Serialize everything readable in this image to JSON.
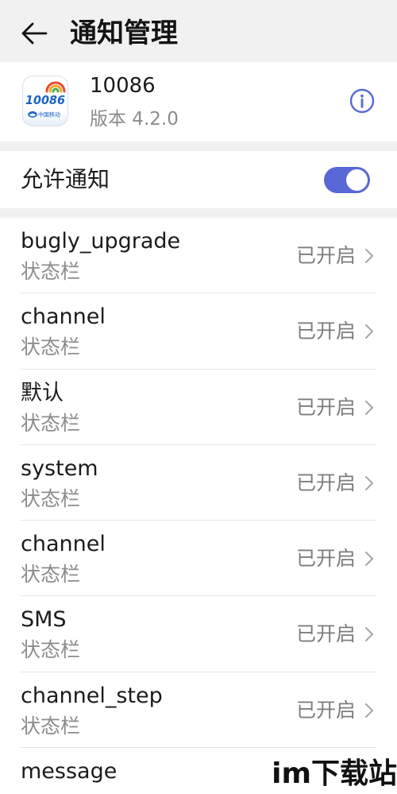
{
  "header": {
    "back_icon": "arrow-left-icon",
    "title": "通知管理"
  },
  "app": {
    "icon": "china-mobile-10086-app-icon",
    "icon_text": "10086",
    "icon_caption": "中国移动",
    "name": "10086",
    "version": "版本 4.2.0",
    "info_icon": "info-circle-icon"
  },
  "allow": {
    "label": "允许通知",
    "enabled": true
  },
  "channels": [
    {
      "title": "bugly_upgrade",
      "subtitle": "状态栏",
      "status": "已开启"
    },
    {
      "title": "channel",
      "subtitle": "状态栏",
      "status": "已开启"
    },
    {
      "title": "默认",
      "subtitle": "状态栏",
      "status": "已开启"
    },
    {
      "title": "system",
      "subtitle": "状态栏",
      "status": "已开启"
    },
    {
      "title": "channel",
      "subtitle": "状态栏",
      "status": "已开启"
    },
    {
      "title": "SMS",
      "subtitle": "状态栏",
      "status": "已开启"
    },
    {
      "title": "channel_step",
      "subtitle": "状态栏",
      "status": "已开启"
    },
    {
      "title": "message"
    }
  ],
  "row_chevron_icon": "chevron-right-icon",
  "watermark": {
    "text": "im下载站"
  },
  "colors": {
    "accent": "#5868d6",
    "background": "#f1f1f1",
    "card": "#ffffff",
    "text_primary": "#1b1b1b",
    "text_secondary": "#8c8c8c"
  }
}
